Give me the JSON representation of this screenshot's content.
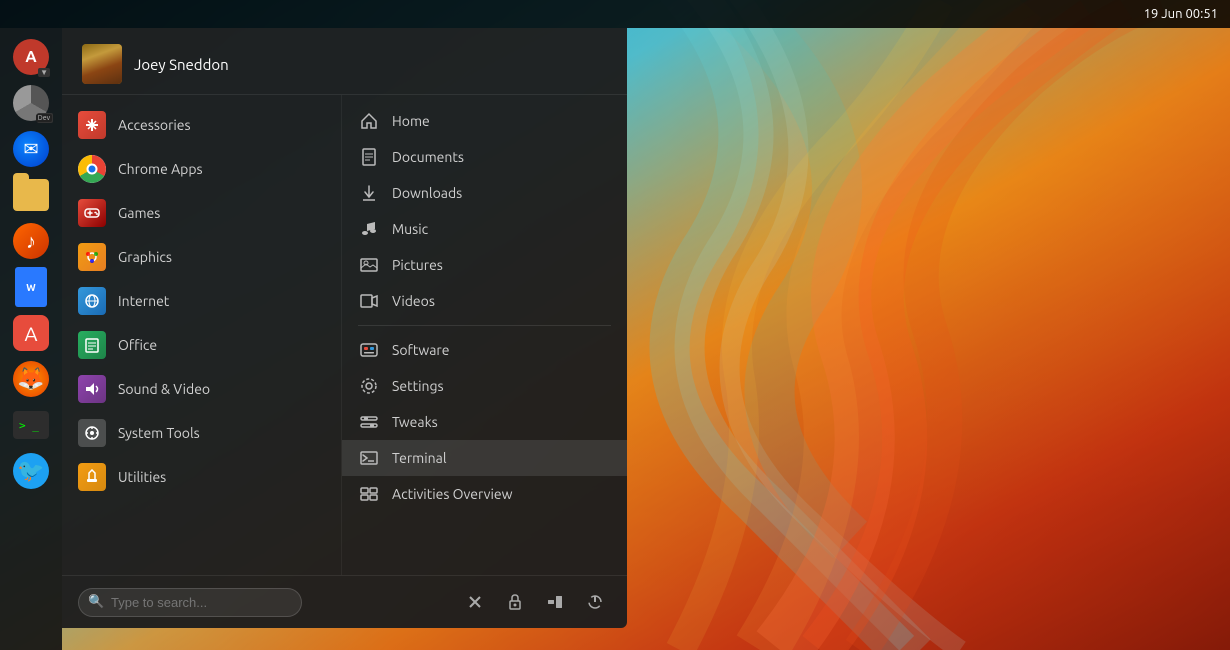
{
  "panel": {
    "clock": "19 Jun  00:51"
  },
  "dock": {
    "items": [
      {
        "name": "archmenu-button",
        "label": "A",
        "type": "archmenu"
      },
      {
        "name": "chrome-dev-icon",
        "label": "",
        "type": "chrome-dev"
      },
      {
        "name": "thunderbird-icon",
        "label": "✉",
        "type": "thunderbird"
      },
      {
        "name": "folder-icon",
        "label": "",
        "type": "folder"
      },
      {
        "name": "rhythmbox-icon",
        "label": "♪",
        "type": "rhythmbox"
      },
      {
        "name": "writer-icon",
        "label": "W",
        "type": "writer"
      },
      {
        "name": "appstore-icon",
        "label": "A",
        "type": "appstore"
      },
      {
        "name": "firefox-icon",
        "label": "🦊",
        "type": "firefox"
      },
      {
        "name": "terminal-dock-icon",
        "label": "> _",
        "type": "terminal"
      },
      {
        "name": "twitter-icon",
        "label": "🐦",
        "type": "twitter"
      }
    ]
  },
  "app_menu": {
    "user_name": "Joey Sneddon",
    "categories": [
      {
        "id": "accessories",
        "label": "Accessories",
        "icon_class": "cat-accessories",
        "icon_char": "✂"
      },
      {
        "id": "chrome-apps",
        "label": "Chrome Apps",
        "icon_class": "cat-chrome",
        "icon_char": ""
      },
      {
        "id": "games",
        "label": "Games",
        "icon_class": "cat-games",
        "icon_char": "🎮"
      },
      {
        "id": "graphics",
        "label": "Graphics",
        "icon_class": "cat-graphics",
        "icon_char": "🎨"
      },
      {
        "id": "internet",
        "label": "Internet",
        "icon_class": "cat-internet",
        "icon_char": "🌐"
      },
      {
        "id": "office",
        "label": "Office",
        "icon_class": "cat-office",
        "icon_char": "📄"
      },
      {
        "id": "sound-video",
        "label": "Sound & Video",
        "icon_class": "cat-sound",
        "icon_char": "🎵"
      },
      {
        "id": "system-tools",
        "label": "System Tools",
        "icon_class": "cat-systemtools",
        "icon_char": "⚙"
      },
      {
        "id": "utilities",
        "label": "Utilities",
        "icon_class": "cat-utilities",
        "icon_char": "🔧"
      }
    ],
    "places": [
      {
        "id": "home",
        "label": "Home",
        "icon": "🏠",
        "section": "places"
      },
      {
        "id": "documents",
        "label": "Documents",
        "icon": "📄",
        "section": "places"
      },
      {
        "id": "downloads",
        "label": "Downloads",
        "icon": "⬇",
        "section": "places"
      },
      {
        "id": "music",
        "label": "Music",
        "icon": "🎵",
        "section": "places"
      },
      {
        "id": "pictures",
        "label": "Pictures",
        "icon": "🖼",
        "section": "places"
      },
      {
        "id": "videos",
        "label": "Videos",
        "icon": "🎬",
        "section": "places"
      }
    ],
    "system": [
      {
        "id": "software",
        "label": "Software",
        "icon": "🛍",
        "section": "system"
      },
      {
        "id": "settings",
        "label": "Settings",
        "icon": "⚙",
        "section": "system"
      },
      {
        "id": "tweaks",
        "label": "Tweaks",
        "icon": "🔧",
        "section": "system"
      },
      {
        "id": "terminal",
        "label": "Terminal",
        "icon": "🖥",
        "section": "system",
        "active": true
      },
      {
        "id": "activities",
        "label": "Activities Overview",
        "icon": "⊞",
        "section": "system"
      }
    ],
    "search_placeholder": "Type to search...",
    "footer_buttons": [
      {
        "id": "close",
        "label": "✕",
        "name": "close-button"
      },
      {
        "id": "lock",
        "label": "🔒",
        "name": "lock-button"
      },
      {
        "id": "suspend",
        "label": "⏸",
        "name": "suspend-button"
      },
      {
        "id": "power",
        "label": "⏻",
        "name": "power-button"
      }
    ]
  }
}
